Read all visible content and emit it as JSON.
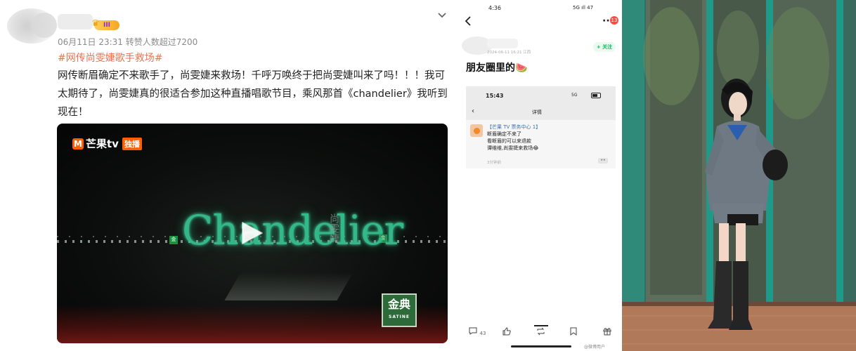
{
  "post": {
    "meta": "06月11日 23:31 转赞人数超过7200",
    "vip_level": "III",
    "hashtag": "#网传尚雯婕歌手救场#",
    "text": "网传断眉确定不来歌手了，尚雯婕来救场！千呼万唤终于把尚雯婕叫来了吗！！！我可太期待了，尚雯婕真的很适合参加这种直播唱歌节目，乘风那首《chandelier》我听到现在！",
    "chevron_icon": "chevron-down-icon"
  },
  "video": {
    "brand": "芒果tv",
    "brand_badge": "独播",
    "title_text": "Chandelier",
    "singer_vertical": "尚雯婕",
    "sponsor": "金典",
    "sponsor_sub": "SATINE",
    "play_icon": "play-icon"
  },
  "phone": {
    "status_time": "4:36",
    "status_right": "5G ıll 47",
    "badge_count": "13",
    "post_date": "2024-06-11 16:21 江西",
    "follow_label": "+ 关注",
    "title": "朋友圈里的🍉",
    "inner": {
      "time": "15:43",
      "signal": "5G",
      "header": "详情",
      "sender": "【芒果 TV 票务中心 1】",
      "lines": [
        "断眉确定不来了",
        "看断眉的可以来退款",
        "谭维维,尚雯婕来救场😂"
      ],
      "ago": "3分钟前",
      "more": "••"
    },
    "bottom": {
      "comments": "43",
      "watermark": "@微博用户"
    }
  },
  "colors": {
    "hashtag": "#eb7350",
    "follow_green": "#18b35a",
    "mango_orange": "#ff5f00",
    "chandelier_green": "#33b889",
    "wall_teal": "#2f7b6e"
  }
}
